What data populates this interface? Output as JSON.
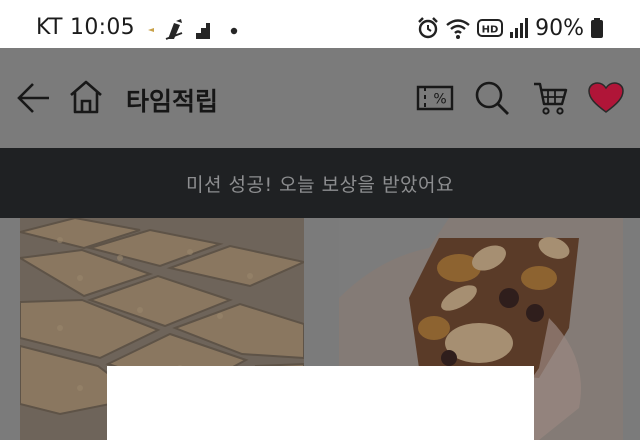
{
  "status_bar": {
    "carrier_time": "KT 10:05",
    "battery": "90%",
    "icons": [
      "notification-icon",
      "pen-icon",
      "app-icon",
      "dot-icon",
      "alarm-icon",
      "wifi-icon",
      "hd-icon",
      "signal-icon",
      "battery-icon"
    ]
  },
  "header": {
    "title": "타임적립",
    "icons": [
      "back-arrow-icon",
      "home-icon",
      "coupon-icon",
      "search-icon",
      "cart-icon",
      "heart-icon"
    ],
    "heart_color": "#b01538",
    "coupon_symbol": "%"
  },
  "banner": {
    "text": "미션 성공! 오늘 보상을 받았어요"
  },
  "products": [
    {
      "name": "product-card-rice-cake",
      "image": "rice-cake-image"
    },
    {
      "name": "product-card-nut-bar",
      "image": "nut-bar-image"
    }
  ],
  "colors": {
    "dim_overlay": "#7b7b7b",
    "banner_bg": "#1f2123",
    "banner_text": "#8d8e90",
    "status_bg": "#ffffff"
  }
}
